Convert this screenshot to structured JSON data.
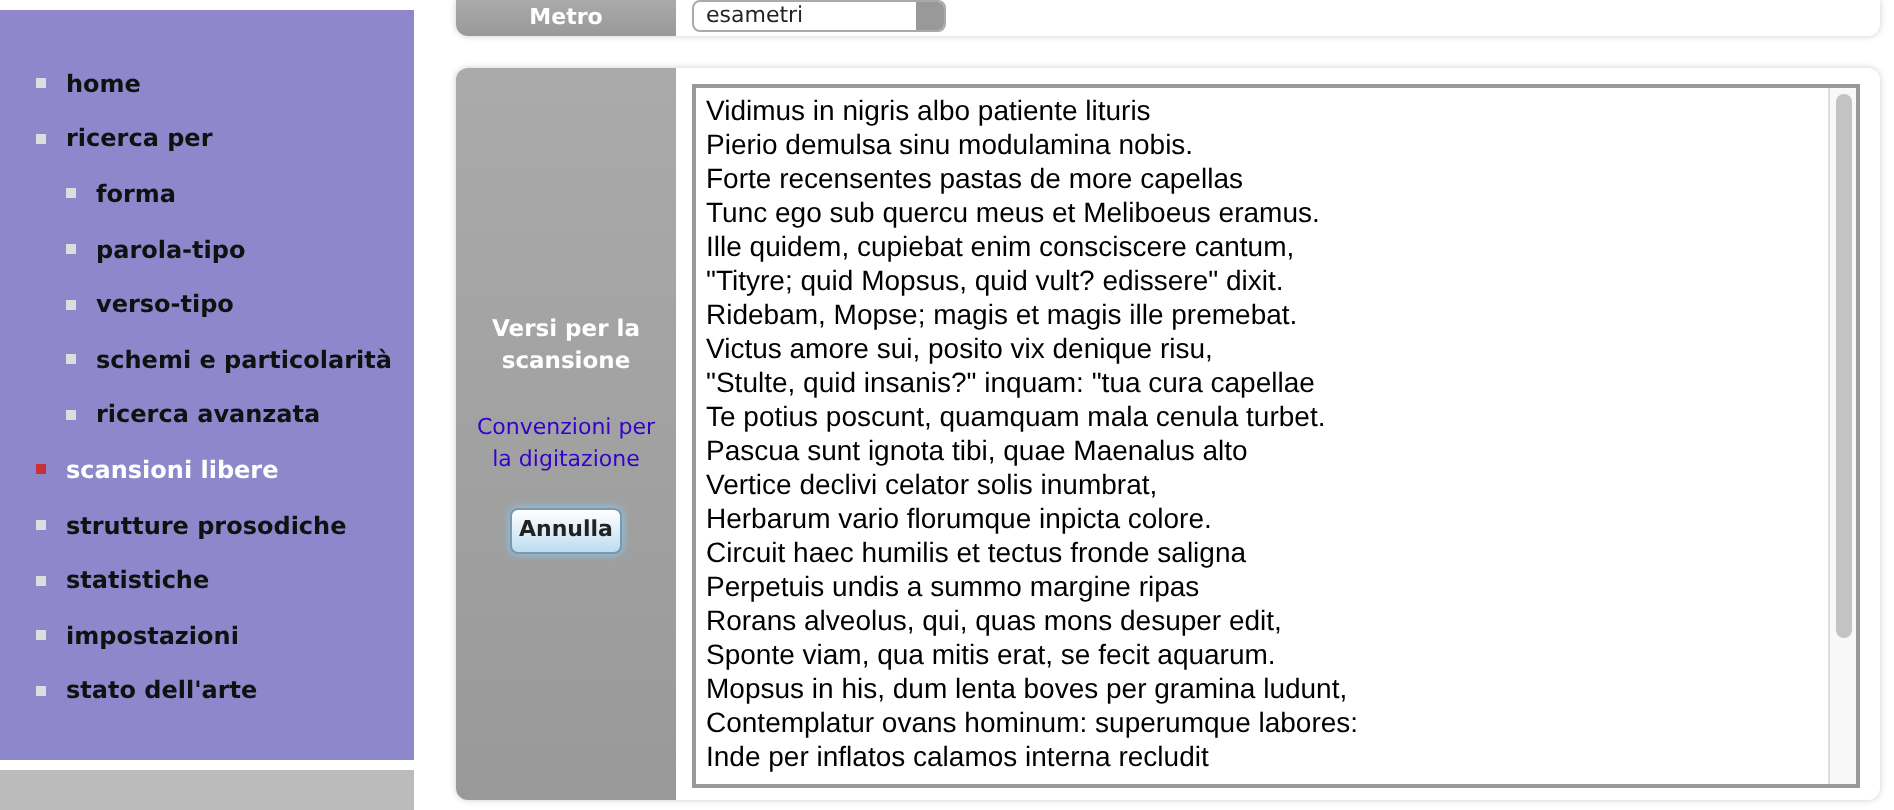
{
  "sidebar": {
    "items": [
      {
        "label": "home",
        "selected": false
      },
      {
        "label": "ricerca per",
        "selected": false,
        "children": [
          {
            "label": "forma",
            "selected": false
          },
          {
            "label": "parola-tipo",
            "selected": false
          },
          {
            "label": "verso-tipo",
            "selected": false
          },
          {
            "label": "schemi e particolarità",
            "selected": false
          },
          {
            "label": "ricerca avanzata",
            "selected": false
          }
        ]
      },
      {
        "label": "scansioni libere",
        "selected": true
      },
      {
        "label": "strutture prosodiche",
        "selected": false
      },
      {
        "label": "statistiche",
        "selected": false
      },
      {
        "label": "impostazioni",
        "selected": false
      },
      {
        "label": "stato dell'arte",
        "selected": false
      }
    ]
  },
  "metro": {
    "label": "Metro",
    "value": "esametri"
  },
  "verses": {
    "label": "Versi per la scansione",
    "link": "Convenzioni per la digitazione",
    "cancel_button": "Annulla",
    "lines": [
      "Vidimus in nigris albo patiente lituris",
      "Pierio demulsa sinu modulamina nobis.",
      "Forte recensentes pastas de more capellas",
      "Tunc ego sub quercu meus et Meliboeus eramus.",
      "Ille quidem, cupiebat enim consciscere cantum,",
      "\"Tityre; quid Mopsus, quid vult? edissere\" dixit.",
      "Ridebam, Mopse; magis et magis ille premebat.",
      "Victus amore sui, posito vix denique risu,",
      "\"Stulte, quid insanis?\" inquam: \"tua cura capellae",
      "Te potius poscunt, quamquam mala cenula turbet.",
      "Pascua sunt ignota tibi, quae Maenalus alto",
      "Vertice declivi celator solis inumbrat,",
      "Herbarum vario florumque inpicta colore.",
      "Circuit haec humilis et tectus fronde saligna",
      "Perpetuis undis a summo margine ripas",
      "Rorans alveolus, qui, quas mons desuper edit,",
      "Sponte viam, qua mitis erat, se fecit aquarum.",
      "Mopsus in his, dum lenta boves per gramina ludunt,",
      "Contemplatur ovans hominum: superumque labores:",
      "Inde per inflatos calamos interna recludit"
    ]
  }
}
